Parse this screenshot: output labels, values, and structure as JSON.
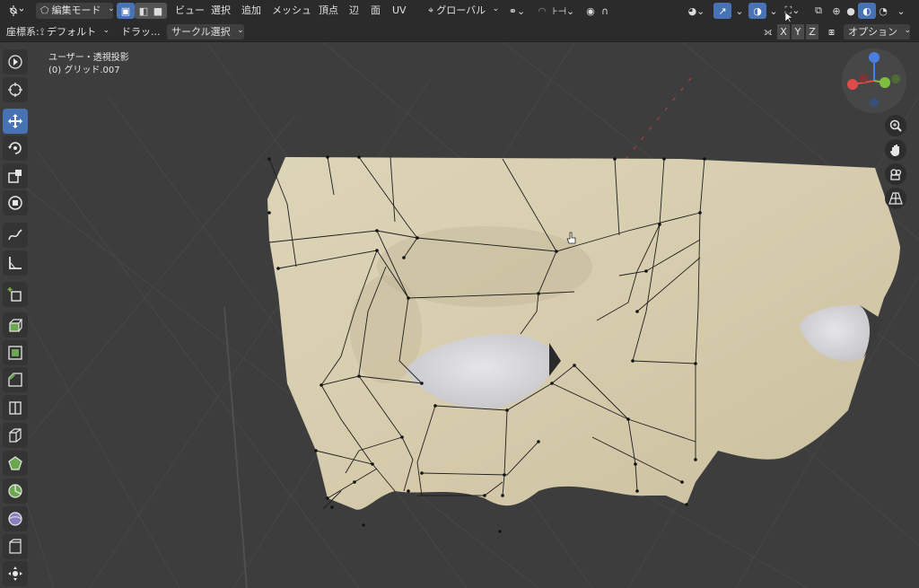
{
  "header": {
    "mode": "編集モード",
    "menu": [
      "ビュー",
      "選択",
      "追加",
      "メッシュ",
      "頂点",
      "辺",
      "面",
      "UV"
    ],
    "transform_orientation": "グローバル"
  },
  "subheader": {
    "coord_label": "座標系:",
    "coord_value": "デフォルト",
    "drag_label": "ドラッ...",
    "select_mode": "サークル選択",
    "axes": [
      "X",
      "Y",
      "Z"
    ],
    "options": "オプション"
  },
  "viewport": {
    "view_name": "ユーザー・透視投影",
    "object_name": "(0) グリッド.007"
  },
  "colors": {
    "accent": "#4772b3",
    "header_bg": "#2b2b2b",
    "viewport_bg": "#3d3d3d",
    "mesh_fill": "#dcd3b6",
    "axis_x": "#e04a4a",
    "axis_y": "#7fbf3f",
    "axis_z": "#4a7fe0"
  },
  "tools": [
    "cursor-icon",
    "cursor-3d-icon",
    "move-icon",
    "rotate-icon",
    "scale-icon",
    "transform-icon",
    "annotate-icon",
    "measure-icon",
    "add-cube-icon",
    "extrude-icon",
    "inset-icon",
    "bevel-icon",
    "loop-cut-icon",
    "knife-icon",
    "poly-build-icon",
    "spin-icon",
    "smooth-icon",
    "edge-slide-icon",
    "shrink-icon"
  ]
}
